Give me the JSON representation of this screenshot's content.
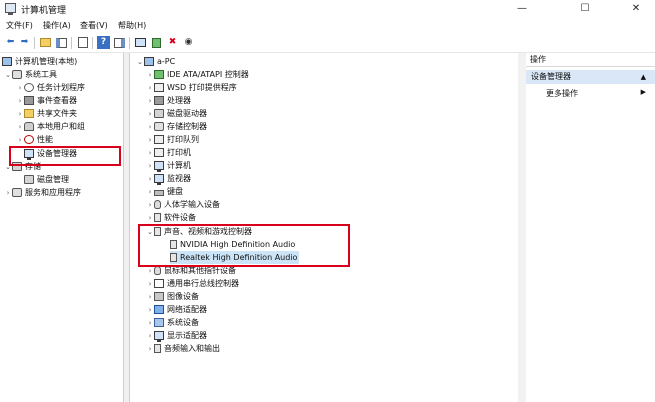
{
  "window": {
    "title": "计算机管理",
    "minimize_glyph": "—",
    "maximize_glyph": "☐",
    "close_glyph": "✕"
  },
  "menu": [
    {
      "label": "文件(F)"
    },
    {
      "label": "操作(A)"
    },
    {
      "label": "查看(V)"
    },
    {
      "label": "帮助(H)"
    }
  ],
  "toolbar": {
    "icons": [
      "back-icon",
      "forward-icon",
      "up-folder-icon",
      "show-hide-tree-icon",
      "properties-icon",
      "help-icon",
      "show-action-pane-icon",
      "scan-hardware-icon",
      "enable-device-icon",
      "uninstall-device-icon",
      "update-driver-icon"
    ],
    "back_glyph": "⬅",
    "forward_glyph": "➡",
    "up_glyph": "▲",
    "help_glyph": "?",
    "uninstall_glyph": "✖",
    "update_glyph": "◉"
  },
  "left_tree": {
    "root": "计算机管理(本地)",
    "system_tools": "系统工具",
    "task_scheduler": "任务计划程序",
    "event_viewer": "事件查看器",
    "shared_folders": "共享文件夹",
    "local_users": "本地用户和组",
    "performance": "性能",
    "device_manager": "设备管理器",
    "storage": "存储",
    "disk_management": "磁盘管理",
    "services_apps": "服务和应用程序"
  },
  "device_tree": {
    "computer_name": "a-PC",
    "categories": [
      {
        "label": "IDE ATA/ATAPI 控制器"
      },
      {
        "label": "WSD 打印提供程序"
      },
      {
        "label": "处理器"
      },
      {
        "label": "磁盘驱动器"
      },
      {
        "label": "存储控制器"
      },
      {
        "label": "打印队列"
      },
      {
        "label": "打印机"
      },
      {
        "label": "计算机"
      },
      {
        "label": "监视器"
      },
      {
        "label": "键盘"
      },
      {
        "label": "人体学输入设备"
      },
      {
        "label": "软件设备"
      },
      {
        "label": "声音、视频和游戏控制器"
      },
      {
        "label": "鼠标和其他指针设备"
      },
      {
        "label": "通用串行总线控制器"
      },
      {
        "label": "图像设备"
      },
      {
        "label": "网络适配器"
      },
      {
        "label": "系统设备"
      },
      {
        "label": "显示适配器"
      },
      {
        "label": "音频输入和输出"
      }
    ],
    "audio_devices": [
      {
        "label": "NVIDIA High Definition Audio"
      },
      {
        "label": "Realtek High Definition Audio"
      }
    ]
  },
  "actions": {
    "header": "操作",
    "section": "设备管理器",
    "more": "更多操作"
  },
  "colors": {
    "highlight_rect": "#d9001b",
    "selection": "#cce4f7",
    "action_section_bg": "#d9e7f6"
  }
}
